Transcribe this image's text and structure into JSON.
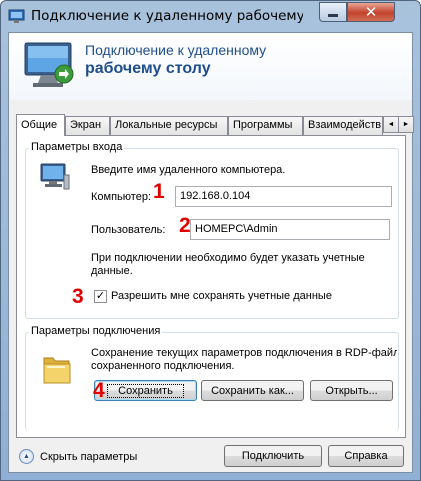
{
  "window": {
    "title": "Подключение к удаленному рабочему ...",
    "close_glyph": "✕"
  },
  "header": {
    "line1": "Подключение к удаленному",
    "line2": "рабочему столу"
  },
  "tabs": [
    {
      "label": "Общие",
      "active": true
    },
    {
      "label": "Экран",
      "active": false
    },
    {
      "label": "Локальные ресурсы",
      "active": false
    },
    {
      "label": "Программы",
      "active": false
    },
    {
      "label": "Взаимодейств",
      "active": false
    }
  ],
  "tab_scroll": {
    "left": "◄",
    "right": "►"
  },
  "login_group": {
    "title": "Параметры входа",
    "prompt": "Введите имя удаленного компьютера.",
    "computer_label": "Компьютер:",
    "computer_value": "192.168.0.104",
    "user_label": "Пользователь:",
    "user_value": "HOMEPC\\Admin",
    "note_line1": "При подключении необходимо будет указать учетные",
    "note_line2": "данные.",
    "checkbox_checked": true,
    "checkbox_mark": "✓",
    "checkbox_label": "Разрешить мне сохранять учетные данные"
  },
  "connection_group": {
    "title": "Параметры подключения",
    "desc_line1": "Сохранение текущих параметров подключения в RDP-файл или",
    "desc_line2": "сохраненного подключения.",
    "save_button": "Сохранить",
    "save_as_button": "Сохранить как...",
    "open_button": "Открыть..."
  },
  "markers": [
    "1",
    "2",
    "3",
    "4"
  ],
  "footer": {
    "hide_arrow": "▲",
    "hide_label": "Скрыть параметры",
    "connect_button": "Подключить",
    "help_button": "Справка"
  },
  "colors": {
    "header_text": "#1f4e8c",
    "marker": "#e00000"
  }
}
